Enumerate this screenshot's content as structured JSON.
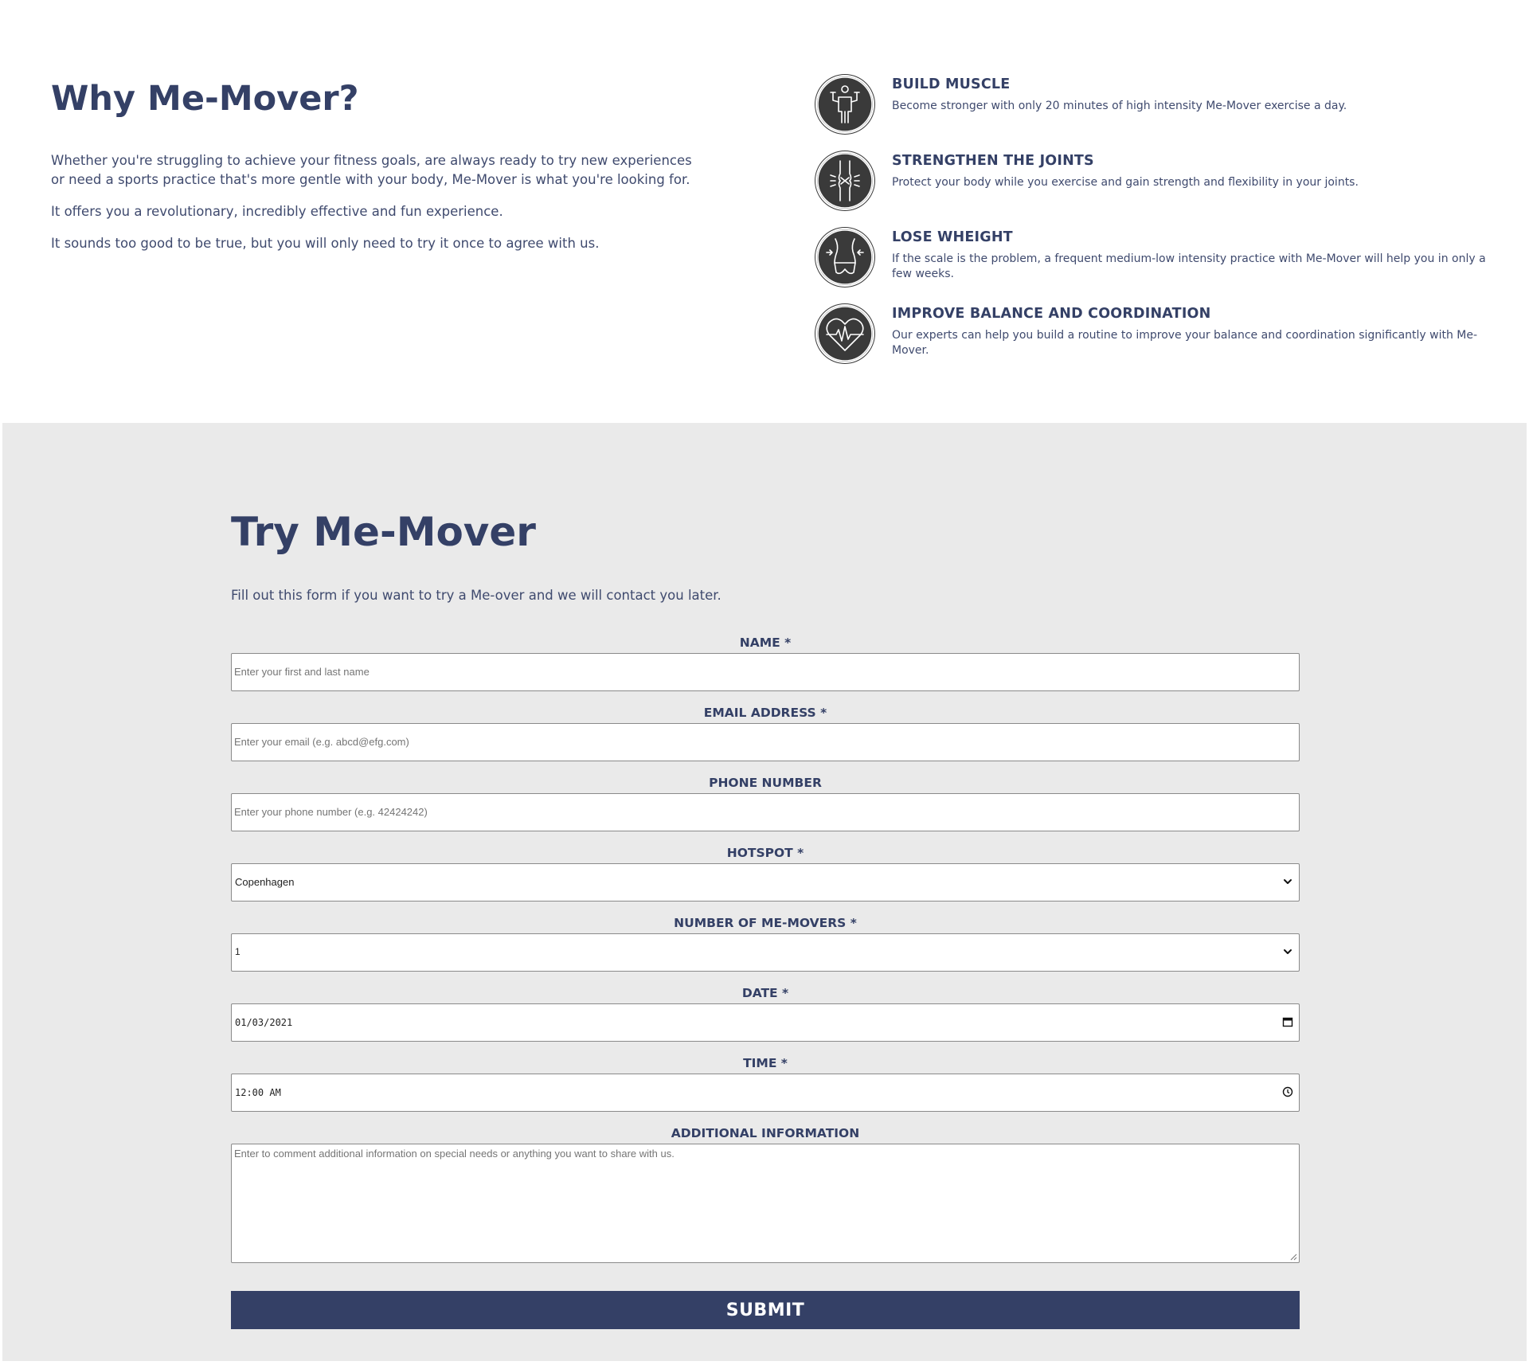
{
  "why": {
    "title": "Why Me-Mover?",
    "paragraphs": [
      "Whether you're struggling to achieve your fitness goals, are always ready to try new experiences or need a sports practice that's more gentle with your body, Me-Mover is what you're looking for.",
      "It offers you a revolutionary, incredibly effective and fun experience.",
      "It sounds too good to be true, but you will only need to try it once to agree with us."
    ],
    "features": [
      {
        "icon": "muscle-icon",
        "title": "BUILD MUSCLE",
        "description": "Become stronger with only 20 minutes of high intensity Me-Mover exercise a day."
      },
      {
        "icon": "joint-icon",
        "title": "STRENGTHEN THE JOINTS",
        "description": "Protect your body while you exercise and gain strength and flexibility in your joints."
      },
      {
        "icon": "waist-icon",
        "title": "LOSE WHEIGHT",
        "description": "If the scale is the problem, a frequent medium-low intensity practice with Me-Mover will help you in only a few weeks."
      },
      {
        "icon": "heart-pulse-icon",
        "title": "IMPROVE BALANCE AND COORDINATION",
        "description": "Our experts can help you build a routine to improve your balance and coordination significantly with Me-Mover."
      }
    ]
  },
  "form": {
    "title": "Try Me-Mover",
    "intro": "Fill out this form if you want to try a Me-over and we will contact you later.",
    "name": {
      "label": "NAME *",
      "placeholder": "Enter your first and last name"
    },
    "email": {
      "label": "EMAIL ADDRESS *",
      "placeholder": "Enter your email (e.g. abcd@efg.com)"
    },
    "phone": {
      "label": "PHONE NUMBER",
      "placeholder": "Enter your phone number (e.g. 42424242)"
    },
    "hotspot": {
      "label": "HOTSPOT *",
      "value": "Copenhagen"
    },
    "count": {
      "label": "NUMBER OF ME-MOVERS *",
      "value": "1"
    },
    "date": {
      "label": "DATE *",
      "value": "01/03/2021"
    },
    "time": {
      "label": "TIME *",
      "value": "12:00 AM"
    },
    "info": {
      "label": "ADDITIONAL INFORMATION",
      "placeholder": "Enter to comment additional information on special needs or anything you want to share with us."
    },
    "submit_label": "SUBMIT"
  },
  "colors": {
    "brand": "#344066",
    "icon_bg": "#3a3a3a",
    "form_bg": "#eaeaea"
  }
}
